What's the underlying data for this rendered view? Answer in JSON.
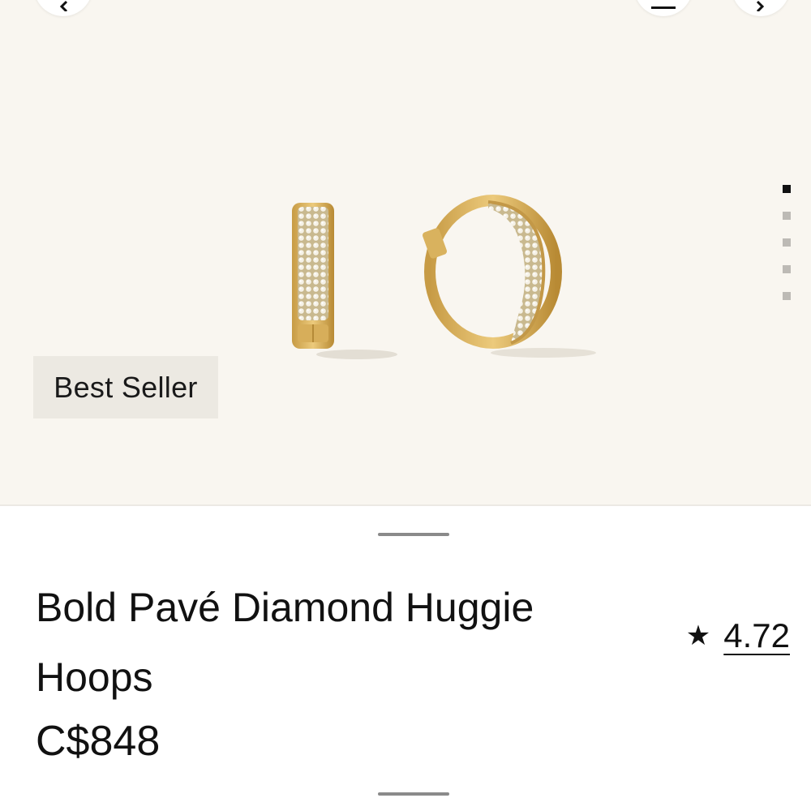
{
  "gallery": {
    "background": "#f9f6f0",
    "badge_label": "Best Seller",
    "pager": {
      "count": 5,
      "active_index": 0
    },
    "nav_icons": [
      "chevron-left-icon",
      "menu-icon",
      "chevron-right-icon"
    ],
    "product_icon": "hoop-earrings-image"
  },
  "product": {
    "title": "Bold Pavé Diamond Huggie Hoops",
    "price": "C$848",
    "rating_star": "★",
    "rating_value": "4.72"
  },
  "colors": {
    "gold": "#d9b25e",
    "gold_dark": "#b98d35",
    "badge_bg": "#ece9e2"
  }
}
